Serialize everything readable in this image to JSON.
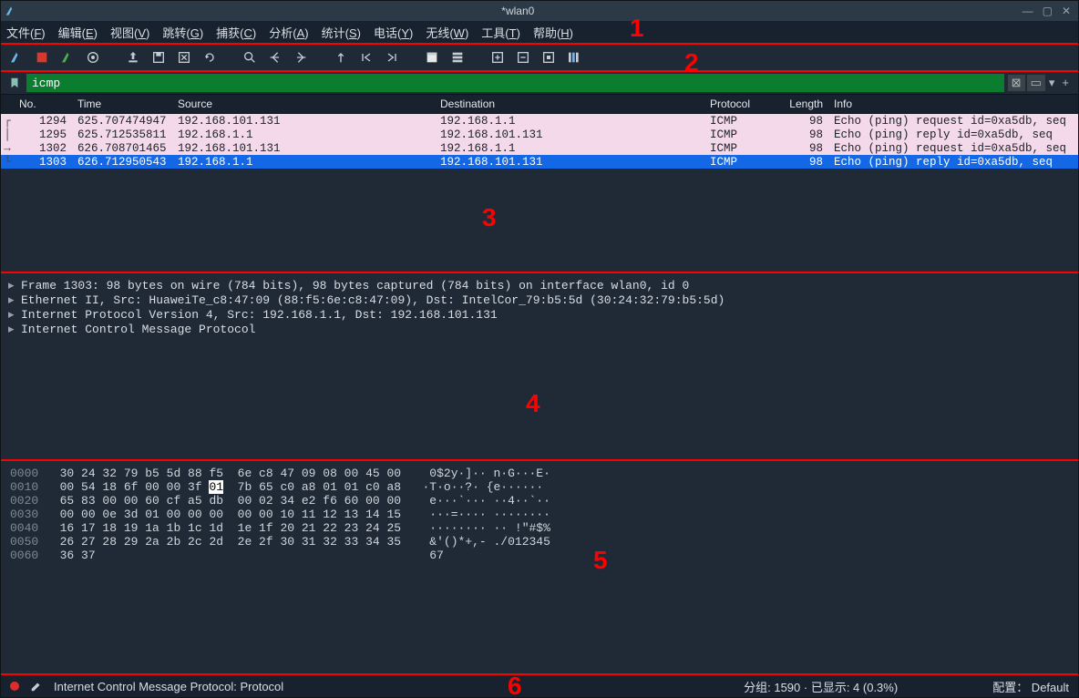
{
  "title": "*wlan0",
  "menus": {
    "file": "文件(",
    "file_u": "F",
    "edit": "编辑(",
    "edit_u": "E",
    "view": "视图(",
    "view_u": "V",
    "go": "跳转(",
    "go_u": "G",
    "cap": "捕获(",
    "cap_u": "C",
    "ana": "分析(",
    "ana_u": "A",
    "stat": "统计(",
    "stat_u": "S",
    "tel": "电话(",
    "tel_u": "Y",
    "wl": "无线(",
    "wl_u": "W",
    "tool": "工具(",
    "tool_u": "T",
    "help": "帮助(",
    "help_u": "H",
    "close": ")"
  },
  "filter": {
    "value": "icmp"
  },
  "cols": {
    "no": "No.",
    "time": "Time",
    "src": "Source",
    "dst": "Destination",
    "proto": "Protocol",
    "len": "Length",
    "info": "Info"
  },
  "rows": [
    {
      "no": "1294",
      "time": "625.707474947",
      "src": "192.168.101.131",
      "dst": "192.168.1.1",
      "proto": "ICMP",
      "len": "98",
      "info": "Echo (ping) request  id=0xa5db, seq"
    },
    {
      "no": "1295",
      "time": "625.712535811",
      "src": "192.168.1.1",
      "dst": "192.168.101.131",
      "proto": "ICMP",
      "len": "98",
      "info": "Echo (ping) reply    id=0xa5db, seq"
    },
    {
      "no": "1302",
      "time": "626.708701465",
      "src": "192.168.101.131",
      "dst": "192.168.1.1",
      "proto": "ICMP",
      "len": "98",
      "info": "Echo (ping) request  id=0xa5db, seq"
    },
    {
      "no": "1303",
      "time": "626.712950543",
      "src": "192.168.1.1",
      "dst": "192.168.101.131",
      "proto": "ICMP",
      "len": "98",
      "info": "Echo (ping) reply    id=0xa5db, seq"
    }
  ],
  "details": [
    "Frame 1303: 98 bytes on wire (784 bits), 98 bytes captured (784 bits) on interface wlan0, id 0",
    "Ethernet II, Src: HuaweiTe_c8:47:09 (88:f5:6e:c8:47:09), Dst: IntelCor_79:b5:5d (30:24:32:79:b5:5d)",
    "Internet Protocol Version 4, Src: 192.168.1.1, Dst: 192.168.101.131",
    "Internet Control Message Protocol"
  ],
  "hex": [
    {
      "off": "0000",
      "h": "30 24 32 79 b5 5d 88 f5  6e c8 47 09 08 00 45 00",
      "a": "0$2y·]·· n·G···E·"
    },
    {
      "off": "0010",
      "h": "00 54 18 6f 00 00 3f 01  7b 65 c0 a8 01 01 c0 a8",
      "a": "·T·o··?· {e······",
      "hi": "01"
    },
    {
      "off": "0020",
      "h": "65 83 00 00 60 cf a5 db  00 02 34 e2 f6 60 00 00",
      "a": "e···`··· ··4··`··"
    },
    {
      "off": "0030",
      "h": "00 00 0e 3d 01 00 00 00  00 00 10 11 12 13 14 15",
      "a": "···=···· ········"
    },
    {
      "off": "0040",
      "h": "16 17 18 19 1a 1b 1c 1d  1e 1f 20 21 22 23 24 25",
      "a": "········ ·· !\"#$%"
    },
    {
      "off": "0050",
      "h": "26 27 28 29 2a 2b 2c 2d  2e 2f 30 31 32 33 34 35",
      "a": "&'()*+,- ./012345"
    },
    {
      "off": "0060",
      "h": "36 37",
      "a": "67"
    }
  ],
  "status": {
    "left": "Internet Control Message Protocol: Protocol",
    "pkts": "分组: 1590 · 已显示: 4 (0.3%)",
    "profile": "配置： Default"
  },
  "labels": {
    "l1": "1",
    "l2": "2",
    "l3": "3",
    "l4": "4",
    "l5": "5",
    "l6": "6"
  }
}
